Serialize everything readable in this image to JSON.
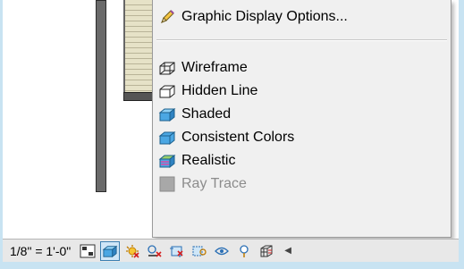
{
  "menu": {
    "graphic_display_options": "Graphic Display Options...",
    "items": [
      {
        "label": "Wireframe",
        "icon": "wireframe-icon",
        "enabled": true
      },
      {
        "label": "Hidden Line",
        "icon": "hidden-line-icon",
        "enabled": true
      },
      {
        "label": "Shaded",
        "icon": "shaded-icon",
        "enabled": true
      },
      {
        "label": "Consistent Colors",
        "icon": "consistent-colors-icon",
        "enabled": true
      },
      {
        "label": "Realistic",
        "icon": "realistic-icon",
        "enabled": true
      },
      {
        "label": "Ray Trace",
        "icon": "ray-trace-icon",
        "enabled": false
      }
    ]
  },
  "statusbar": {
    "scale": "1/8\" = 1'-0\"",
    "icons": [
      "detail-level-icon",
      "visual-style-icon",
      "sun-path-icon",
      "shadows-icon",
      "crop-view-icon",
      "show-crop-region-icon",
      "temporary-hide-icon",
      "reveal-hidden-icon",
      "analytical-model-icon"
    ]
  },
  "colors": {
    "accent": "#3c7fb1",
    "shaded_fill": "#3a9bd9",
    "background": "#c8e3f2"
  }
}
